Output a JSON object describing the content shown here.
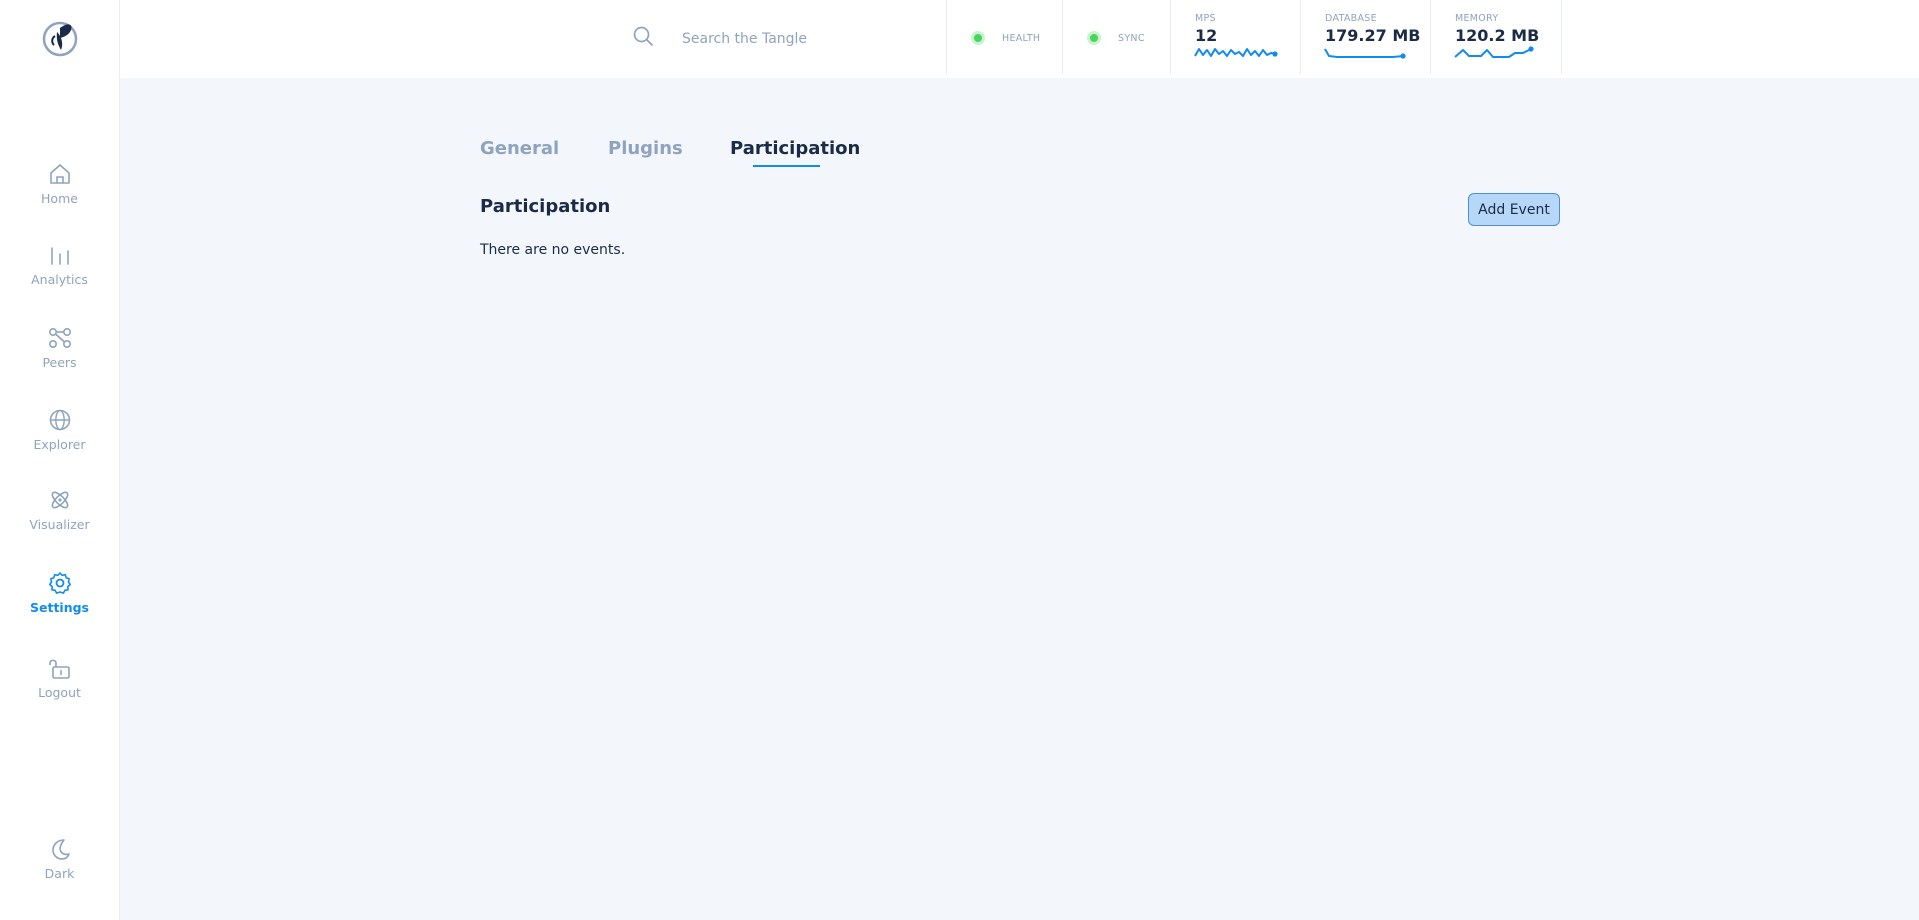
{
  "sidebar": {
    "items": [
      {
        "label": "Home",
        "icon": "home-icon",
        "active": false
      },
      {
        "label": "Analytics",
        "icon": "bar-chart-icon",
        "active": false
      },
      {
        "label": "Peers",
        "icon": "peers-icon",
        "active": false
      },
      {
        "label": "Explorer",
        "icon": "globe-icon",
        "active": false
      },
      {
        "label": "Visualizer",
        "icon": "atom-icon",
        "active": false
      },
      {
        "label": "Settings",
        "icon": "gear-icon",
        "active": true
      },
      {
        "label": "Logout",
        "icon": "unlock-icon",
        "active": false
      }
    ],
    "theme_toggle": {
      "label": "Dark",
      "icon": "moon-icon"
    }
  },
  "header": {
    "search": {
      "placeholder": "Search the Tangle",
      "value": ""
    },
    "health": {
      "label": "HEALTH",
      "status_color": "#4bd35e"
    },
    "sync": {
      "label": "SYNC",
      "status_color": "#4bd35e"
    },
    "mps": {
      "label": "MPS",
      "value": "12"
    },
    "database": {
      "label": "DATABASE",
      "value": "179.27 MB"
    },
    "memory": {
      "label": "MEMORY",
      "value": "120.2 MB"
    }
  },
  "tabs": [
    {
      "label": "General",
      "active": false
    },
    {
      "label": "Plugins",
      "active": false
    },
    {
      "label": "Participation",
      "active": true
    }
  ],
  "main": {
    "title": "Participation",
    "add_button_label": "Add Event",
    "empty_message": "There are no events."
  },
  "colors": {
    "accent": "#108cee",
    "muted": "#8fa3be",
    "text": "#1b2b47",
    "background": "#f3f7fc",
    "healthy": "#4bd35e"
  }
}
